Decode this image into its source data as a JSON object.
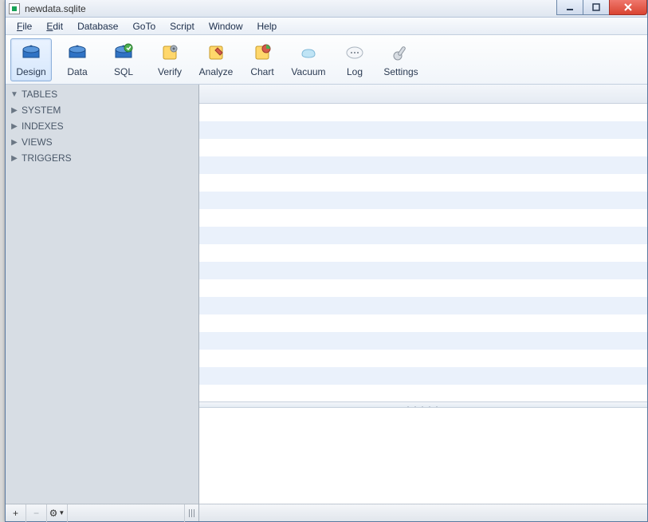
{
  "window": {
    "title": "newdata.sqlite"
  },
  "menu": {
    "file": "File",
    "file_ul": "F",
    "edit": "Edit",
    "edit_ul": "E",
    "database": "Database",
    "goto": "GoTo",
    "script": "Script",
    "window": "Window",
    "help": "Help"
  },
  "toolbar": {
    "design": "Design",
    "data": "Data",
    "sql": "SQL",
    "verify": "Verify",
    "analyze": "Analyze",
    "chart": "Chart",
    "vacuum": "Vacuum",
    "log": "Log",
    "settings": "Settings"
  },
  "tree": {
    "items": [
      {
        "label": "TABLES",
        "expanded": true
      },
      {
        "label": "SYSTEM",
        "expanded": false
      },
      {
        "label": "INDEXES",
        "expanded": false
      },
      {
        "label": "VIEWS",
        "expanded": false
      },
      {
        "label": "TRIGGERS",
        "expanded": false
      }
    ]
  },
  "sidebar_footer": {
    "add": "+",
    "remove": "−",
    "gear": "⚙"
  },
  "splitter_dots": ". . . . ."
}
